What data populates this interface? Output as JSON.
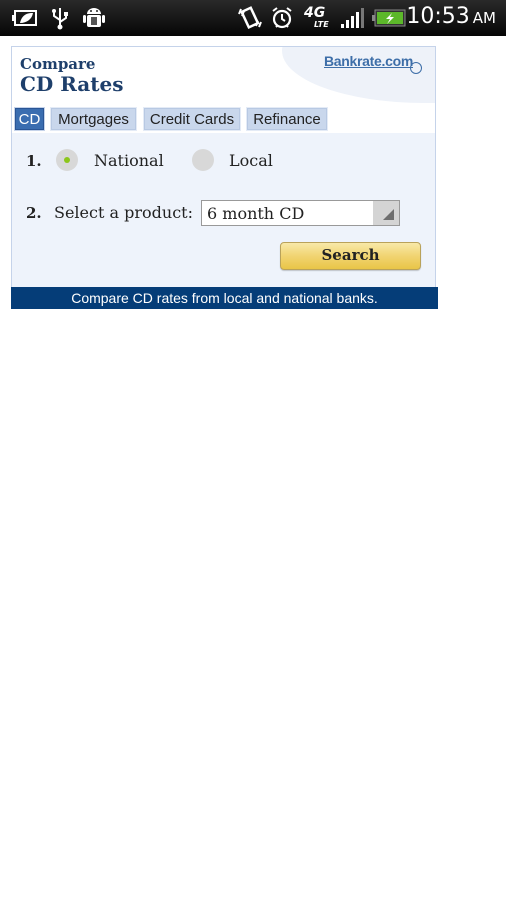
{
  "status_bar": {
    "left_icons": [
      "battery-saver-icon",
      "usb-icon",
      "android-debug-icon"
    ],
    "right_icons": [
      "vibrate-icon",
      "alarm-icon",
      "4g-lte-icon",
      "signal-icon",
      "battery-charging-icon"
    ],
    "network_label": "4G",
    "network_sub": "LTE",
    "time": "10:53",
    "ampm": "AM"
  },
  "widget": {
    "title_small": "Compare",
    "title_large": "CD Rates",
    "logo": "Bankrate.com",
    "tabs": [
      {
        "label": "CD",
        "active": true
      },
      {
        "label": "Mortgages",
        "active": false
      },
      {
        "label": "Credit Cards",
        "active": false
      },
      {
        "label": "Refinance",
        "active": false
      }
    ],
    "step1": {
      "number": "1.",
      "options": [
        {
          "label": "National",
          "selected": true
        },
        {
          "label": "Local",
          "selected": false
        }
      ]
    },
    "step2": {
      "number": "2.",
      "label": "Select a product:",
      "selected_value": "6 month CD"
    },
    "search_label": "Search",
    "footer_text": "Compare CD rates from local and national banks."
  },
  "colors": {
    "brand_blue": "#1e3f6b",
    "footer_bg": "#053d78",
    "active_tab": "#3a6db0",
    "radio_selected": "#8cc61b",
    "button_gold": "#f1d472"
  }
}
